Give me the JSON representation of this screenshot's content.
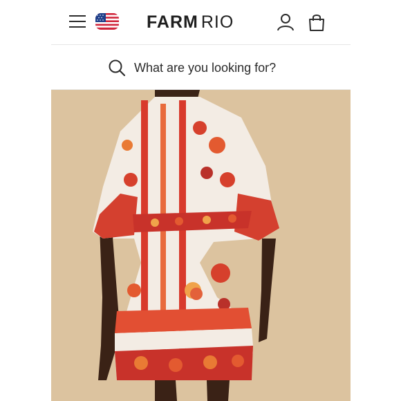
{
  "header": {
    "brand_primary": "FARM",
    "brand_secondary": "RIO",
    "icons": [
      "menu-icon",
      "us-flag-icon",
      "user-icon",
      "shopping-bag-icon"
    ]
  },
  "search": {
    "placeholder": "What are you looking for?",
    "icon": "search-icon"
  },
  "colors": {
    "background": "#ffffff",
    "photo_background": "#dcc39f",
    "dress_red": "#c8322a",
    "dress_orange": "#e8603a",
    "text": "#1e1e1e"
  }
}
